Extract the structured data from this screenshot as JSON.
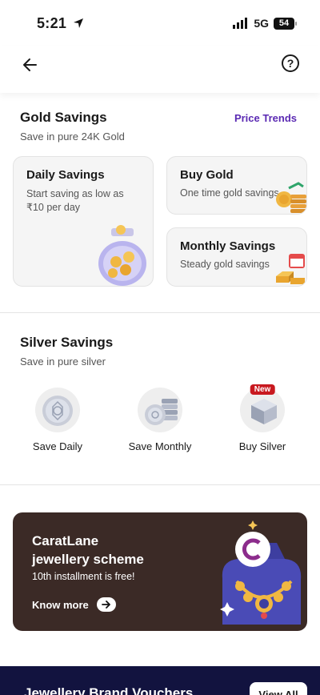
{
  "status_bar": {
    "time": "5:21",
    "network": "5G",
    "battery": "54"
  },
  "header": {
    "back_icon": "arrow-left-icon",
    "help_icon": "question-circle-icon",
    "help_glyph": "?"
  },
  "gold": {
    "title": "Gold Savings",
    "subtitle": "Save in pure 24K Gold",
    "price_trends": "Price Trends",
    "cards": [
      {
        "title": "Daily Savings",
        "desc_line1": "Start saving as low as",
        "desc_line2": "₹10 per day",
        "icon": "gold-coin-jar-icon"
      },
      {
        "title": "Buy Gold",
        "desc": "One time gold savings",
        "icon": "gold-coins-stack-icon"
      },
      {
        "title": "Monthly Savings",
        "desc": "Steady gold savings",
        "icon": "gold-bars-calendar-icon"
      }
    ]
  },
  "silver": {
    "title": "Silver Savings",
    "subtitle": "Save in pure silver",
    "items": [
      {
        "label": "Save Daily",
        "icon": "silver-coin-icon"
      },
      {
        "label": "Save Monthly",
        "icon": "silver-coins-stack-icon"
      },
      {
        "label": "Buy Silver",
        "icon": "silver-bar-icon",
        "badge": "New"
      }
    ]
  },
  "promo": {
    "title_line1": "CaratLane",
    "title_line2": "jewellery scheme",
    "subtitle": "10th installment is free!",
    "cta": "Know more",
    "colors": {
      "background": "#3b2a26",
      "accent": "#4a4bb6"
    }
  },
  "bottom": {
    "title": "Jewellery Brand Vouchers",
    "button": "View All"
  },
  "colors": {
    "accent_purple": "#5b2ab3",
    "badge_red": "#c8191f",
    "banner_navy": "#12133f"
  }
}
